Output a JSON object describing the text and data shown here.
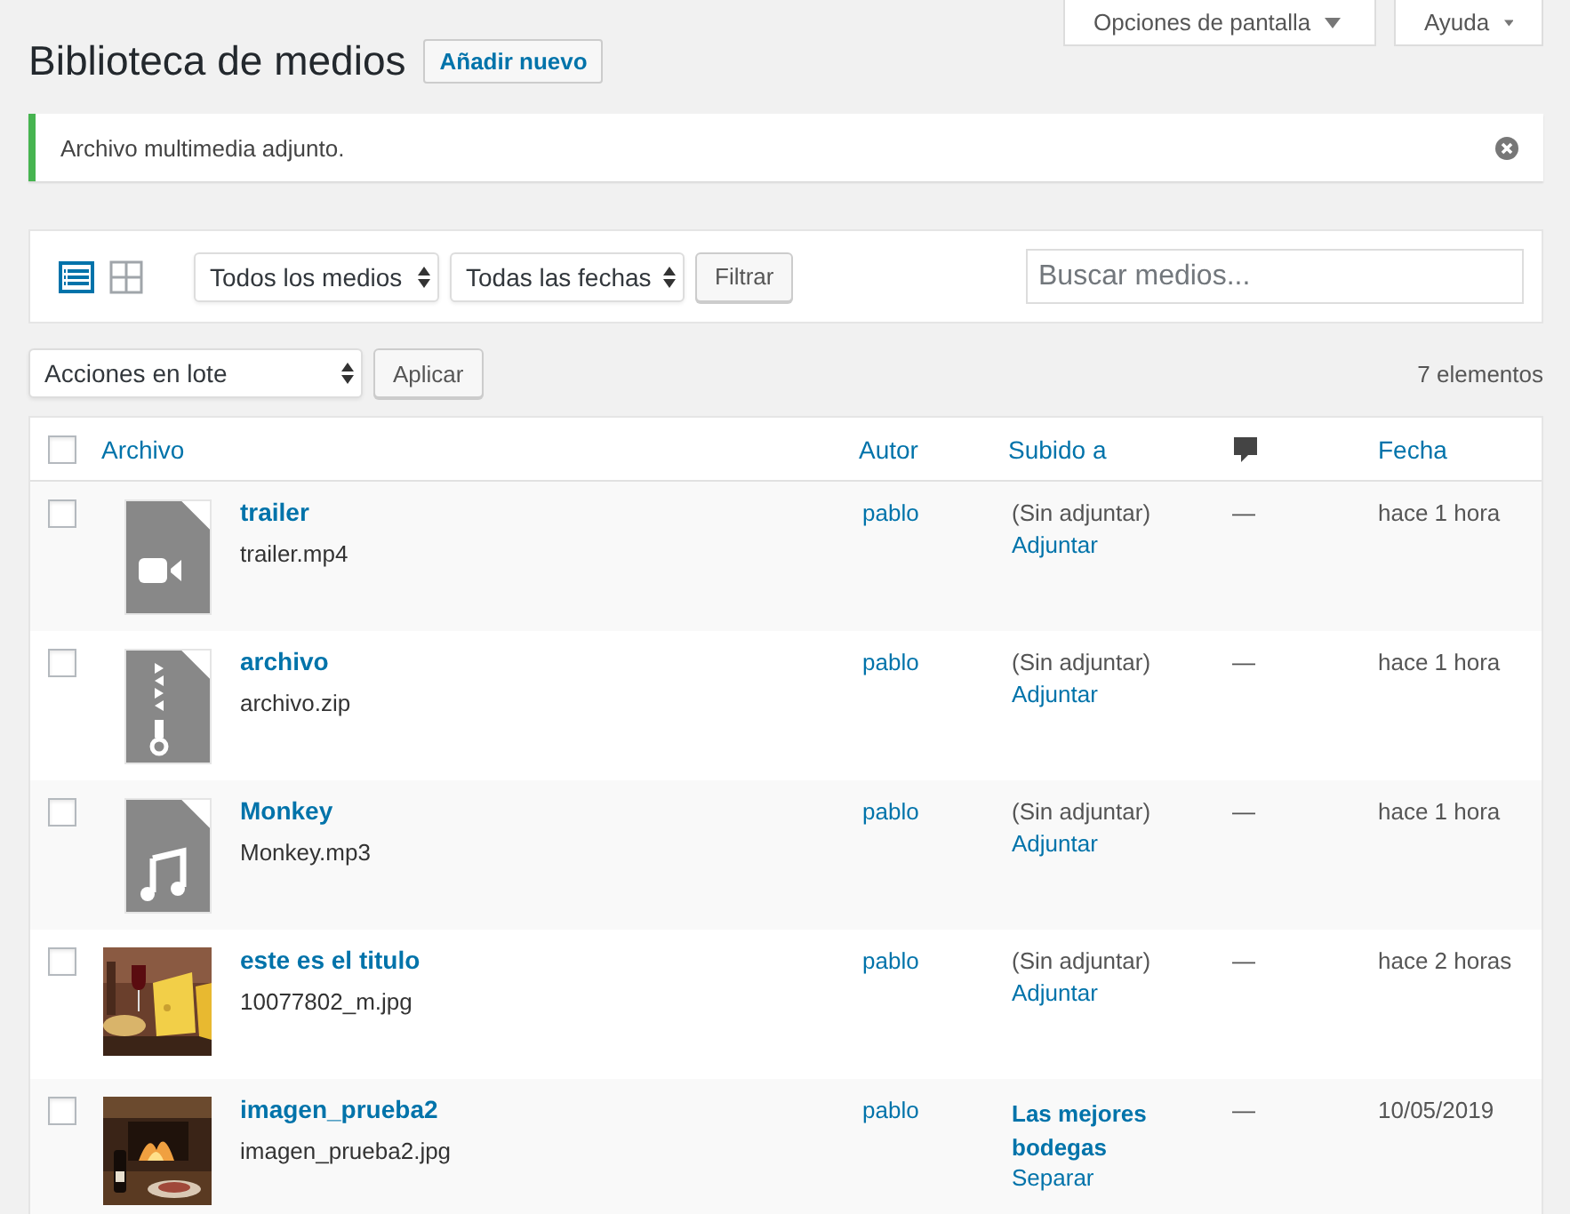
{
  "header_tabs": [
    {
      "label": "Opciones de pantalla"
    },
    {
      "label": "Ayuda"
    }
  ],
  "title": "Biblioteca de medios",
  "add_new": "Añadir nuevo",
  "notice": {
    "text": "Archivo multimedia adjunto."
  },
  "view_modes": [
    {
      "kind": "list",
      "selected": true
    },
    {
      "kind": "grid",
      "selected": false
    }
  ],
  "filters": {
    "type_select": "Todos los medios",
    "date_select": "Todas las fechas",
    "button": "Filtrar",
    "search": {
      "placeholder": "Buscar medios..."
    }
  },
  "bulk": {
    "select": "Acciones en lote",
    "button": "Aplicar",
    "count": "7 elementos"
  },
  "table": {
    "select_all": {
      "checked": false
    },
    "columns": [
      "Archivo",
      "Autor",
      "Subido a",
      "Fecha"
    ],
    "rows": [
      {
        "checked": false,
        "thumb": {
          "kind": "video"
        },
        "title": "trailer",
        "file": "trailer.mp4",
        "author": "pablo",
        "uploaded_to": {
          "kind": "unattached",
          "text": "(Sin adjuntar)",
          "action": "Adjuntar"
        },
        "comments": "—",
        "date": "hace 1 hora"
      },
      {
        "checked": false,
        "thumb": {
          "kind": "archive"
        },
        "title": "archivo",
        "file": "archivo.zip",
        "author": "pablo",
        "uploaded_to": {
          "kind": "unattached",
          "text": "(Sin adjuntar)",
          "action": "Adjuntar"
        },
        "comments": "—",
        "date": "hace 1 hora"
      },
      {
        "checked": false,
        "thumb": {
          "kind": "audio"
        },
        "title": "Monkey",
        "file": "Monkey.mp3",
        "author": "pablo",
        "uploaded_to": {
          "kind": "unattached",
          "text": "(Sin adjuntar)",
          "action": "Adjuntar"
        },
        "comments": "—",
        "date": "hace 1 hora"
      },
      {
        "checked": false,
        "title": "este es el titulo",
        "file": "10077802_m.jpg",
        "author": "pablo",
        "uploaded_to": {
          "kind": "unattached",
          "text": "(Sin adjuntar)",
          "action": "Adjuntar"
        },
        "comments": "—",
        "date": "hace 2 horas"
      },
      {
        "checked": false,
        "title": "imagen_prueba2",
        "file": "imagen_prueba2.jpg",
        "author": "pablo",
        "uploaded_to": {
          "kind": "parent",
          "text": "Las mejores bodegas",
          "action": "Separar"
        },
        "comments": "—",
        "date": "10/05/2019"
      }
    ]
  }
}
